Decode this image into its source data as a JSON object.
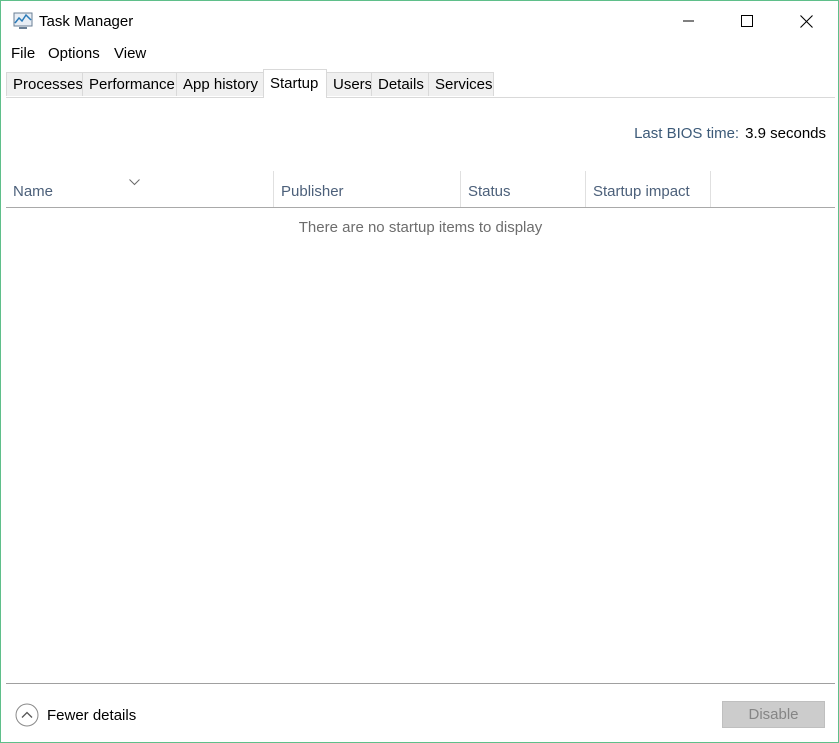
{
  "window": {
    "title": "Task Manager",
    "border_color": "#5fbf8a",
    "icons": {
      "app": "task-manager-icon",
      "minimize": "minimize-icon",
      "maximize": "maximize-icon",
      "close": "close-icon"
    }
  },
  "menu": [
    "File",
    "Options",
    "View"
  ],
  "tabs": [
    {
      "label": "Processes",
      "active": false
    },
    {
      "label": "Performance",
      "active": false
    },
    {
      "label": "App history",
      "active": false
    },
    {
      "label": "Startup",
      "active": true
    },
    {
      "label": "Users",
      "active": false
    },
    {
      "label": "Details",
      "active": false
    },
    {
      "label": "Services",
      "active": false
    }
  ],
  "bios": {
    "label": "Last BIOS time:",
    "value": "3.9 seconds"
  },
  "table": {
    "columns": [
      "Name",
      "Publisher",
      "Status",
      "Startup impact"
    ],
    "sorted_column": "Name",
    "sort_icon": "chevron-down-icon",
    "empty_message": "There are no startup items to display",
    "rows": []
  },
  "footer": {
    "fewer_details": "Fewer details",
    "fewer_icon": "chevron-up-circle-icon",
    "disable_button": "Disable",
    "disable_enabled": false
  }
}
